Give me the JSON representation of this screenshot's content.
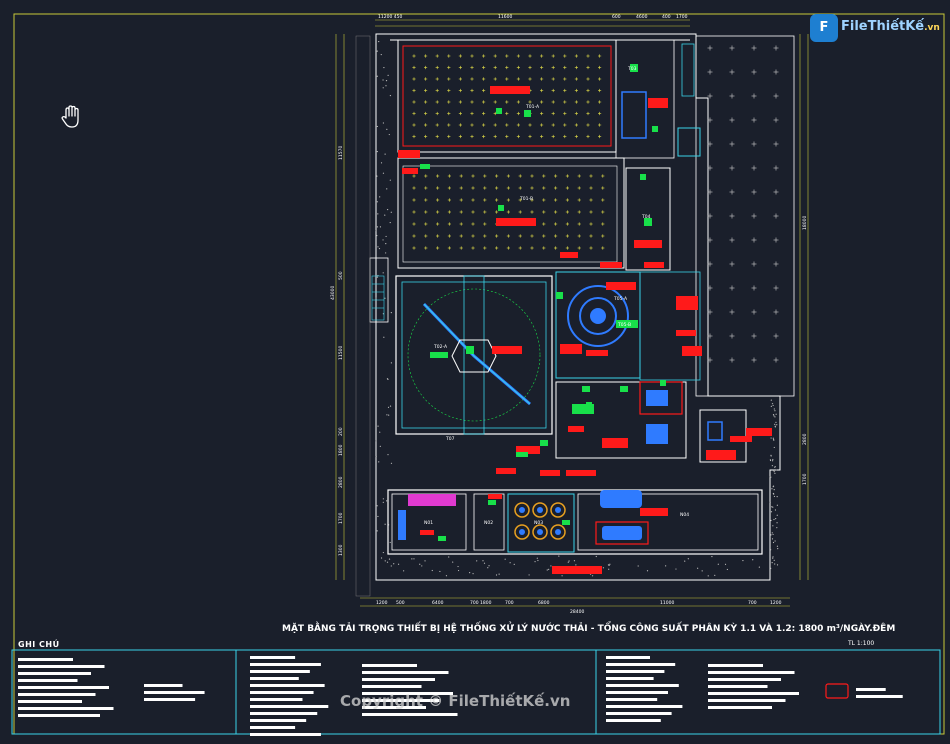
{
  "logo": {
    "mark": "F",
    "name": "FileThiếtKế",
    "suffix": ".vn"
  },
  "title": "MẶT BẰNG TẢI TRỌNG THIẾT BỊ HỆ THỐNG XỬ LÝ NƯỚC THẢI - TỔNG CÔNG SUẤT PHÂN KỲ 1.1 VÀ 1.2: 1800 m³/NGÀY.ĐÊM",
  "scale": "TL 1:100",
  "notes_title": "GHI CHÚ",
  "watermark": "Copyright © FileThiếtKế.vn",
  "dimensions": {
    "top": [
      "11200 450",
      "11600",
      "600",
      "4600",
      "400",
      "1700"
    ],
    "bottom": [
      "1200",
      "500",
      "6400",
      "700 1800",
      "700",
      "6800",
      "11000",
      "700",
      "1200"
    ],
    "bottom_total": "28400",
    "left": [
      "11570",
      "43000",
      "500",
      "11500",
      "200",
      "1800",
      "2800",
      "1700",
      "1300"
    ],
    "right": [
      "18000",
      "2800",
      "1700"
    ]
  },
  "tank_labels": [
    "T01-A",
    "T01-B",
    "T02-A",
    "T03",
    "T04",
    "T05-A",
    "T05-B",
    "T07",
    "N01",
    "N02",
    "N03",
    "N04"
  ],
  "icons": [
    "hand-pan-icon",
    "logo-icon"
  ],
  "colors": {
    "background": "#1a1f2b",
    "wall": "#ffffff",
    "cyan": "#39d3e8",
    "green": "#18e04a",
    "red": "#ff1a1a",
    "blue": "#2f7bff",
    "yellow": "#e8e34a",
    "magenta": "#e03ad0"
  }
}
